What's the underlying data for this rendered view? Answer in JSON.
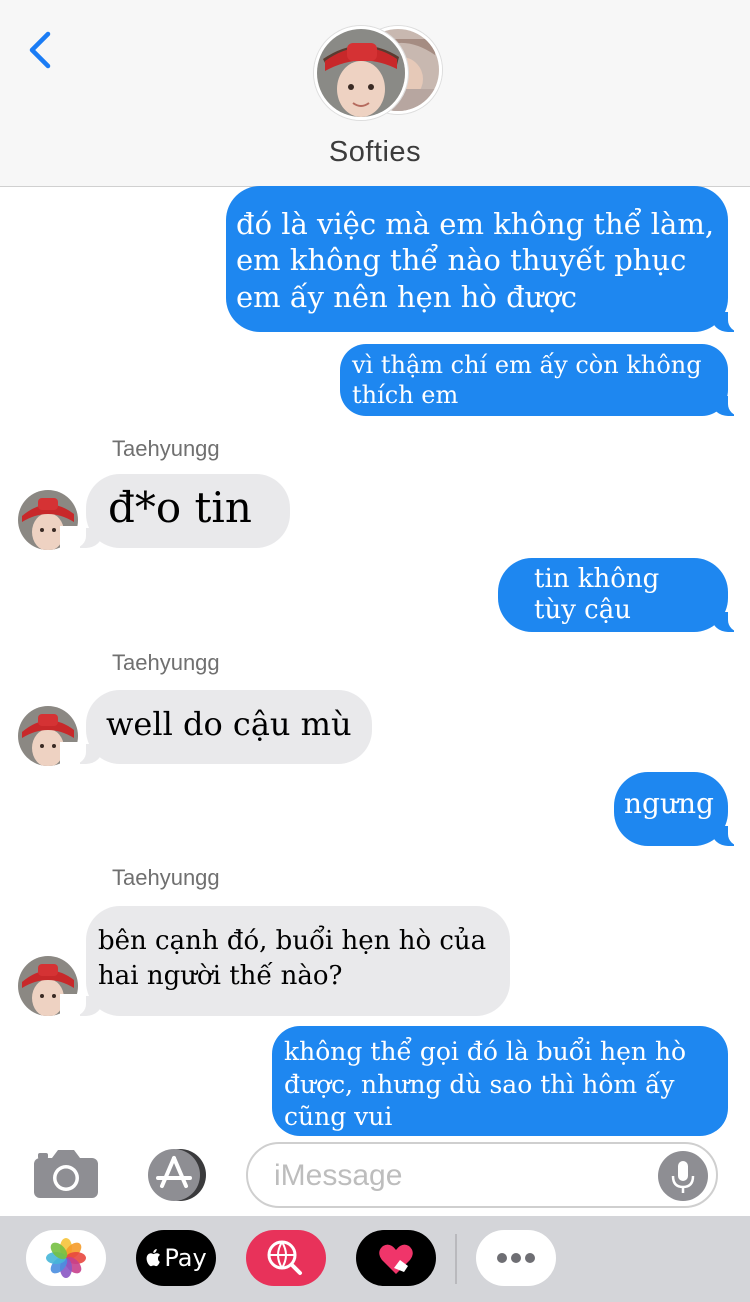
{
  "header": {
    "title": "Softies"
  },
  "messages": [
    {
      "direction": "outgoing",
      "text_lines": [
        "đó là việc mà em không thể làm,",
        "em không thể nào thuyết phục",
        "em ấy nên hẹn hò được"
      ]
    },
    {
      "direction": "outgoing",
      "text_lines": [
        "vì thậm chí em ấy còn không",
        "thích em"
      ]
    },
    {
      "direction": "incoming",
      "sender": "Taehyungg",
      "text_lines": [
        "đ*o tin"
      ]
    },
    {
      "direction": "outgoing",
      "text_lines": [
        "tin không",
        "tùy cậu"
      ]
    },
    {
      "direction": "incoming",
      "sender": "Taehyungg",
      "text_lines": [
        "well do cậu mù"
      ]
    },
    {
      "direction": "outgoing",
      "text_lines": [
        "ngưng"
      ]
    },
    {
      "direction": "incoming",
      "sender": "Taehyungg",
      "text_lines": [
        "bên cạnh đó, buổi hẹn hò của",
        "hai người thế nào?"
      ]
    },
    {
      "direction": "outgoing",
      "text_lines": [
        "không thể gọi đó là buổi hẹn hò",
        "được, nhưng dù sao thì hôm ấy",
        "cũng vui"
      ]
    }
  ],
  "input": {
    "placeholder": "iMessage"
  },
  "apps": {
    "items": [
      {
        "name": "photos-app-icon"
      },
      {
        "name": "apple-pay",
        "label": "Pay"
      },
      {
        "name": "web-search-app-icon"
      },
      {
        "name": "digital-touch-app-icon"
      },
      {
        "name": "more-apps-icon"
      }
    ]
  },
  "colors": {
    "outgoing_bubble": "#1e87f0",
    "incoming_bubble": "#e9e9eb",
    "accent": "#1a7cf5"
  }
}
